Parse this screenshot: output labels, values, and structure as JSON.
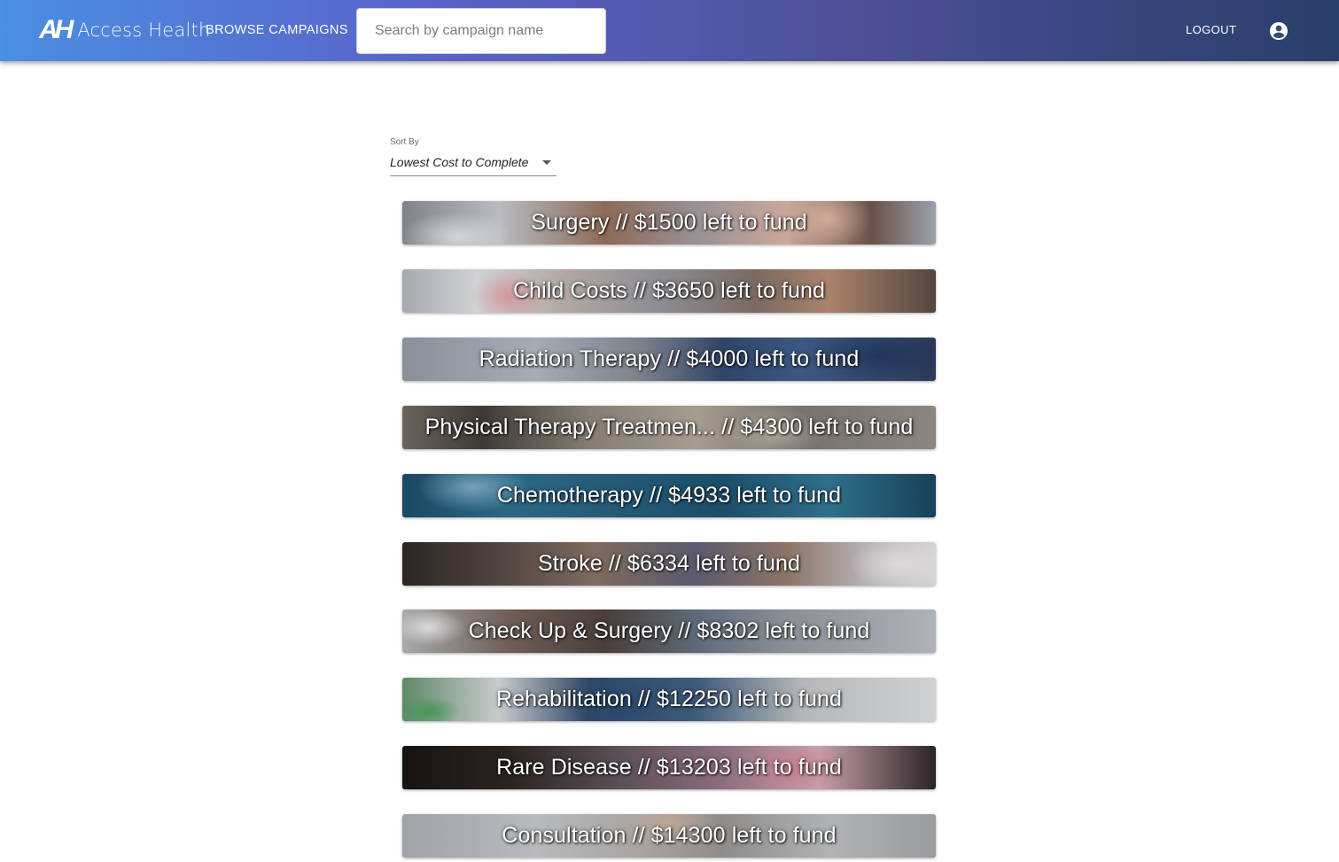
{
  "header": {
    "logo_mark": "AH",
    "logo_text": "Access Health",
    "nav_browse": "BROWSE CAMPAIGNS",
    "search_placeholder": "Search by campaign name",
    "logout": "LOGOUT",
    "account_icon": "account-circle-icon"
  },
  "sort": {
    "label": "Sort By",
    "value": "Lowest Cost to Complete"
  },
  "campaigns": [
    {
      "title": "Surgery // $1500 left to fund"
    },
    {
      "title": "Child Costs // $3650 left to fund"
    },
    {
      "title": "Radiation Therapy // $4000 left to fund"
    },
    {
      "title": "Physical Therapy Treatmen... // $4300 left to fund"
    },
    {
      "title": "Chemotherapy // $4933 left to fund"
    },
    {
      "title": "Stroke // $6334 left to fund"
    },
    {
      "title": "Check Up & Surgery // $8302 left to fund"
    },
    {
      "title": "Rehabilitation // $12250 left to fund"
    },
    {
      "title": "Rare Disease // $13203 left to fund"
    },
    {
      "title": "Consultation // $14300 left to fund"
    }
  ],
  "colors": {
    "appbar_start": "#4a8fe0",
    "appbar_mid": "#5a63c8",
    "appbar_end": "#283e6a"
  }
}
